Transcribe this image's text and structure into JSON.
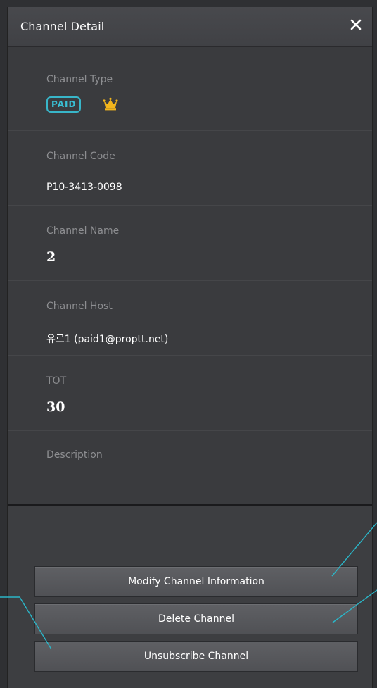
{
  "window": {
    "title": "Channel Detail"
  },
  "fields": {
    "channel_type": {
      "label": "Channel Type",
      "badge": "PAID",
      "badge_color": "#38b6c9",
      "icon": "crown-icon",
      "icon_color": "#f2b51c"
    },
    "channel_code": {
      "label": "Channel Code",
      "value": "P10-3413-0098"
    },
    "channel_name": {
      "label": "Channel Name",
      "value": "2"
    },
    "channel_host": {
      "label": "Channel Host",
      "value": "유르1 (paid1@proptt.net)"
    },
    "tot": {
      "label": "TOT",
      "value": "30"
    },
    "description": {
      "label": "Description",
      "value": ""
    }
  },
  "buttons": {
    "modify": "Modify Channel Information",
    "delete": "Delete Channel",
    "unsubscribe": "Unsubscribe Channel"
  },
  "colors": {
    "callout_line": "#2bb6c8"
  }
}
